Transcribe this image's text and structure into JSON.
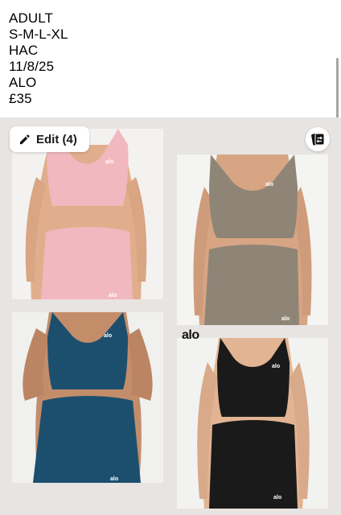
{
  "caption": {
    "lines": [
      "ADULT",
      "S-M-L-XL",
      "HAC",
      "11/8/25",
      "ALO",
      "£35"
    ]
  },
  "toolbar": {
    "edit_label": "Edit (4)"
  },
  "photos": [
    {
      "garment_color": "#f2b8bf",
      "logo": "alo"
    },
    {
      "garment_color": "#8e8577",
      "logo": "alo"
    },
    {
      "garment_color": "#1c4f6e",
      "logo": "alo"
    },
    {
      "garment_color": "#1a1a1a",
      "logo": "alo"
    }
  ],
  "stray_text": "alo",
  "colors": {
    "gallery_bg": "#e7e4e2",
    "accent": "#000000"
  }
}
